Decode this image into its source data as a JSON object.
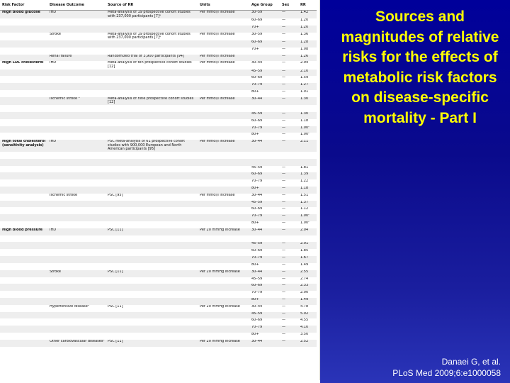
{
  "slide": {
    "title": "Sources and magnitudes of relative risks for the effects of metabolic risk factors on disease-specific mortality - Part I",
    "citation_line1": "Danaei G, et al.",
    "citation_line2": "PLoS Med 2009;6:e1000058",
    "background_color": "#0a0a8c",
    "title_color": "#ffff00"
  },
  "table": {
    "headers": [
      "Risk Factor",
      "Disease Outcome",
      "Source of RR",
      "Units",
      "Age Group",
      "Sex",
      "RR"
    ],
    "rows": [
      {
        "shade": true,
        "c": [
          "High blood glucose",
          "IHD",
          "Meta-analysis of 19 prospective cohort studies with 237,000 participants [7]ᵃ",
          "Per mmol/l increase",
          "30–59",
          "—",
          "1.42"
        ]
      },
      {
        "shade": false,
        "c": [
          "",
          "",
          "",
          "",
          "60–69",
          "—",
          "1.20"
        ]
      },
      {
        "shade": true,
        "c": [
          "",
          "",
          "",
          "",
          "70+",
          "—",
          "1.20"
        ]
      },
      {
        "shade": false,
        "c": [
          "",
          "Stroke",
          "Meta-analysis of 19 prospective cohort studies with 237,000 participants [7]ᵃ",
          "Per mmol/l increase",
          "30–59",
          "—",
          "1.36"
        ]
      },
      {
        "shade": true,
        "c": [
          "",
          "",
          "",
          "",
          "60–69",
          "—",
          "1.28"
        ]
      },
      {
        "shade": false,
        "c": [
          "",
          "",
          "",
          "",
          "70+",
          "—",
          "1.08"
        ]
      },
      {
        "shade": true,
        "c": [
          "",
          "Renal failure",
          "Randomized trial of 3,900 participants [94]",
          "Per mmol/l increase",
          "",
          "—",
          "1.26"
        ]
      },
      {
        "shade": false,
        "c": [
          "High LDL cholesterol",
          "IHD",
          "Meta-analysis of ten prospective cohort studies [12]",
          "Per mmol/l increase",
          "30–44",
          "—",
          "2.94"
        ]
      },
      {
        "shade": true,
        "c": [
          "",
          "",
          "",
          "",
          "45–59",
          "—",
          "2.10"
        ]
      },
      {
        "shade": false,
        "c": [
          "",
          "",
          "",
          "",
          "60–69",
          "—",
          "1.59"
        ]
      },
      {
        "shade": true,
        "c": [
          "",
          "",
          "",
          "",
          "70–79",
          "—",
          "1.27"
        ]
      },
      {
        "shade": false,
        "c": [
          "",
          "",
          "",
          "",
          "80+",
          "—",
          "1.01"
        ]
      },
      {
        "shade": true,
        "c": [
          "",
          "Ischemic stroke ᵇ",
          "Meta-analysis of nine prospective cohort studies [12]",
          "Per mmol/l increase",
          "30–44",
          "—",
          "1.30"
        ]
      },
      {
        "shade": false,
        "c": [
          "",
          "",
          "",
          "",
          "",
          "",
          ""
        ]
      },
      {
        "shade": true,
        "c": [
          "",
          "",
          "",
          "",
          "45–59",
          "—",
          "1.30"
        ]
      },
      {
        "shade": false,
        "c": [
          "",
          "",
          "",
          "",
          "60–69",
          "—",
          "1.18"
        ]
      },
      {
        "shade": true,
        "c": [
          "",
          "",
          "",
          "",
          "70–79",
          "—",
          "1.00ᶜ"
        ]
      },
      {
        "shade": false,
        "c": [
          "",
          "",
          "",
          "",
          "80+",
          "—",
          "1.00ᶜ"
        ]
      },
      {
        "shade": true,
        "c": [
          "High total cholesterol (sensitivity analysis)",
          "IHD",
          "PSC meta-analysis of 61 prospective cohort studies with 900,000 European and North American participants [95]",
          "Per mmol/l increase",
          "30–44",
          "—",
          "2.11"
        ]
      },
      {
        "shade": false,
        "c": [
          "",
          "",
          "",
          "",
          "",
          "",
          ""
        ]
      },
      {
        "shade": true,
        "c": [
          "",
          "",
          "",
          "",
          "",
          "",
          ""
        ]
      },
      {
        "shade": false,
        "c": [
          "",
          "",
          "",
          "",
          "45–59",
          "—",
          "1.81"
        ]
      },
      {
        "shade": true,
        "c": [
          "",
          "",
          "",
          "",
          "60–69",
          "—",
          "1.39"
        ]
      },
      {
        "shade": false,
        "c": [
          "",
          "",
          "",
          "",
          "70–79",
          "—",
          "1.22"
        ]
      },
      {
        "shade": true,
        "c": [
          "",
          "",
          "",
          "",
          "80+",
          "—",
          "1.18"
        ]
      },
      {
        "shade": false,
        "c": [
          "",
          "Ischemic stroke",
          "PSC [95]",
          "Per mmol/l increase",
          "30–44",
          "—",
          "1.51"
        ]
      },
      {
        "shade": true,
        "c": [
          "",
          "",
          "",
          "",
          "45–59",
          "—",
          "1.37"
        ]
      },
      {
        "shade": false,
        "c": [
          "",
          "",
          "",
          "",
          "60–69",
          "—",
          "1.12"
        ]
      },
      {
        "shade": true,
        "c": [
          "",
          "",
          "",
          "",
          "70–79",
          "—",
          "1.00ᶜ"
        ]
      },
      {
        "shade": false,
        "c": [
          "",
          "",
          "",
          "",
          "80+",
          "—",
          "1.00ᶜ"
        ]
      },
      {
        "shade": true,
        "c": [
          "High blood pressure",
          "IHD",
          "PSC [11]",
          "Per 20 mmHg increase",
          "30–44",
          "—",
          "2.04"
        ]
      },
      {
        "shade": false,
        "c": [
          "",
          "",
          "",
          "",
          "",
          "",
          ""
        ]
      },
      {
        "shade": true,
        "c": [
          "",
          "",
          "",
          "",
          "45–59",
          "—",
          "2.01"
        ]
      },
      {
        "shade": false,
        "c": [
          "",
          "",
          "",
          "",
          "60–69",
          "—",
          "1.85"
        ]
      },
      {
        "shade": true,
        "c": [
          "",
          "",
          "",
          "",
          "70–79",
          "—",
          "1.67"
        ]
      },
      {
        "shade": false,
        "c": [
          "",
          "",
          "",
          "",
          "80+",
          "—",
          "1.49"
        ]
      },
      {
        "shade": true,
        "c": [
          "",
          "Stroke",
          "PSC [11]",
          "Per 20 mmHg increase",
          "30–44",
          "—",
          "2.55"
        ]
      },
      {
        "shade": false,
        "c": [
          "",
          "",
          "",
          "",
          "45–59",
          "—",
          "2.74"
        ]
      },
      {
        "shade": true,
        "c": [
          "",
          "",
          "",
          "",
          "60–69",
          "—",
          "2.33"
        ]
      },
      {
        "shade": false,
        "c": [
          "",
          "",
          "",
          "",
          "70–79",
          "—",
          "2.00"
        ]
      },
      {
        "shade": true,
        "c": [
          "",
          "",
          "",
          "",
          "80+",
          "—",
          "1.49"
        ]
      },
      {
        "shade": false,
        "c": [
          "",
          "Hypertensive diseaseᵇ",
          "PSC [11]",
          "Per 20 mmHg increase",
          "30–44",
          "—",
          "4.78"
        ]
      },
      {
        "shade": true,
        "c": [
          "",
          "",
          "",
          "",
          "45–59",
          "—",
          "5.02"
        ]
      },
      {
        "shade": false,
        "c": [
          "",
          "",
          "",
          "",
          "60–69",
          "—",
          "4.55"
        ]
      },
      {
        "shade": true,
        "c": [
          "",
          "",
          "",
          "",
          "70–79",
          "—",
          "4.10"
        ]
      },
      {
        "shade": false,
        "c": [
          "",
          "",
          "",
          "",
          "80+",
          "—",
          "3.50"
        ]
      },
      {
        "shade": true,
        "c": [
          "",
          "Other cardiovascular diseasesᵈ",
          "PSC [11]",
          "Per 20 mmHg increase",
          "30–44",
          "—",
          "2.52"
        ]
      }
    ]
  }
}
